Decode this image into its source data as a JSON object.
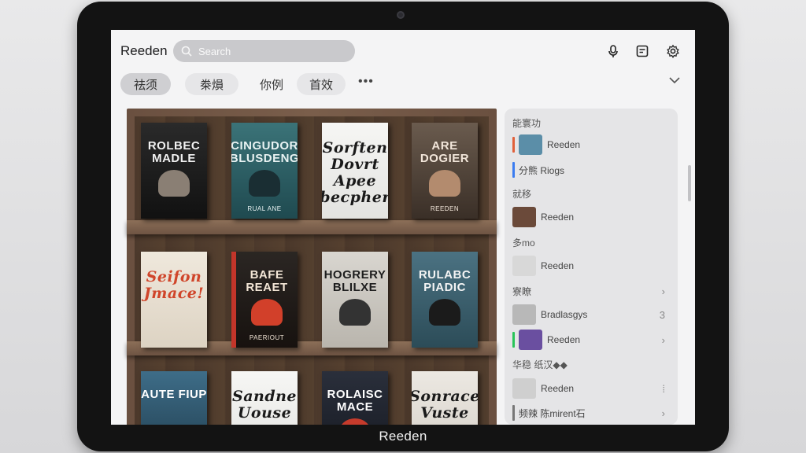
{
  "app": {
    "title": "Reeden",
    "device_label": "Reeden"
  },
  "search": {
    "placeholder": "Search"
  },
  "header_icons": [
    "microphone-icon",
    "note-icon",
    "settings-icon"
  ],
  "tabs": [
    {
      "label": "祛须",
      "active": true
    },
    {
      "label": "桊熉",
      "active": false
    },
    {
      "label": "你例",
      "active": false
    },
    {
      "label": "首效",
      "active": false
    }
  ],
  "more_label": "•••",
  "shelf": {
    "rows": [
      [
        {
          "title": "ROLBEC MADLE",
          "subtitle": "",
          "style": "dark"
        },
        {
          "title": "CINGUDOR BLUSDENG",
          "subtitle": "RUAL ANE",
          "style": "teal"
        },
        {
          "title": "Sorften Dovrt Apee becpher",
          "subtitle": "",
          "style": "white"
        },
        {
          "title": "ARE DOGIER",
          "subtitle": "REEDEN",
          "style": "brown"
        }
      ],
      [
        {
          "title": "Seifon Jmace!",
          "subtitle": "",
          "style": "cream"
        },
        {
          "title": "BAFE REAET",
          "subtitle": "PAERIOUT",
          "style": "red"
        },
        {
          "title": "HOGRERY BLILXE",
          "subtitle": "",
          "style": "grey"
        },
        {
          "title": "RULABC PIADIC",
          "subtitle": "",
          "style": "blue"
        }
      ],
      [
        {
          "title": "AUTE FIUP",
          "subtitle": "",
          "style": "bw"
        },
        {
          "title": "Sandne Uouse",
          "subtitle": "",
          "style": "white"
        },
        {
          "title": "ROLAISC MACE",
          "subtitle": "",
          "style": "navy"
        },
        {
          "title": "Sonrace Vuste",
          "subtitle": "",
          "style": "paper"
        }
      ]
    ]
  },
  "panel": {
    "rows": [
      {
        "type": "section",
        "label": "能寰功"
      },
      {
        "type": "item",
        "label": "Reeden",
        "accent": "#e0603a",
        "thumb": "#5b8ea8"
      },
      {
        "type": "item",
        "label": "分熊 Riogs",
        "accent": "#3b7cf0",
        "thumb": ""
      },
      {
        "type": "section",
        "label": "就移"
      },
      {
        "type": "item",
        "label": "Reeden",
        "accent": "",
        "thumb": "#6b4a3a"
      },
      {
        "type": "section",
        "label": "多mo"
      },
      {
        "type": "item",
        "label": "Reeden",
        "accent": "",
        "thumb": "#d8d8d8"
      },
      {
        "type": "section",
        "label": "寮瞭",
        "right": "›"
      },
      {
        "type": "item",
        "label": "Bradlasgys",
        "accent": "",
        "thumb": "#b8b8b8",
        "right": "3"
      },
      {
        "type": "item",
        "label": "Reeden",
        "accent": "#29c45a",
        "thumb": "#6a4fa0",
        "right": "›"
      },
      {
        "type": "section",
        "label": "华稳   纸汉◆◆"
      },
      {
        "type": "item",
        "label": "Reeden",
        "accent": "",
        "thumb": "#cfcfcf",
        "right": "⁞"
      },
      {
        "type": "item",
        "label": "频辣   陈mirent石",
        "accent": "#777777",
        "thumb": "",
        "right": "›"
      }
    ]
  }
}
